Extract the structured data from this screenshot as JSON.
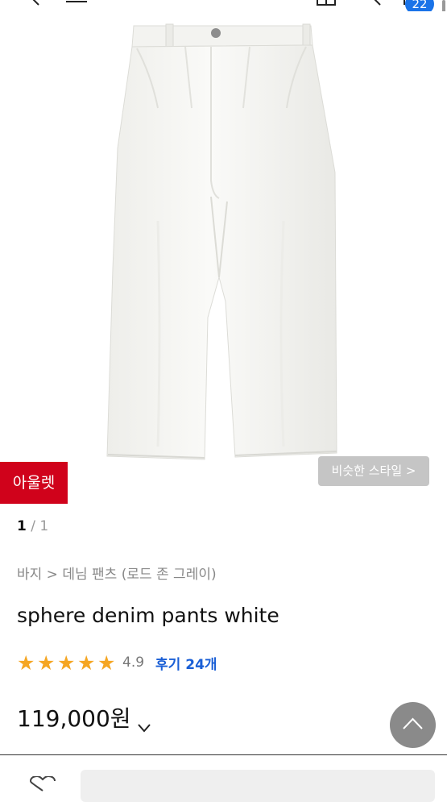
{
  "header": {
    "back_icon": "chevron-left-icon",
    "menu_icon": "hamburger-icon",
    "home_icon": "home-icon",
    "search_icon": "search-icon",
    "cart_icon": "cart-icon",
    "cart_count": "22",
    "accent": "#1a73e8"
  },
  "gallery": {
    "image_label": "white pleated wide pants product photo",
    "outlet_badge": "아울렛",
    "similar_button": "비슷한 스타일 >",
    "page_current": "1",
    "page_sep": " / ",
    "page_total": "1"
  },
  "product": {
    "breadcrumb": "바지 > 데님 팬츠 (로드 존 그레이)",
    "name": "sphere denim pants white",
    "stars": 5,
    "rating": "4.9",
    "review_label": "후기 24개",
    "price": "119,000원"
  },
  "colors": {
    "outlet": "#d0021b",
    "star": "#f5a623",
    "review_link": "#1a5fd6"
  },
  "footer": {
    "scroll_top_icon": "chevron-up-icon",
    "heart_icon": "heart-icon"
  }
}
